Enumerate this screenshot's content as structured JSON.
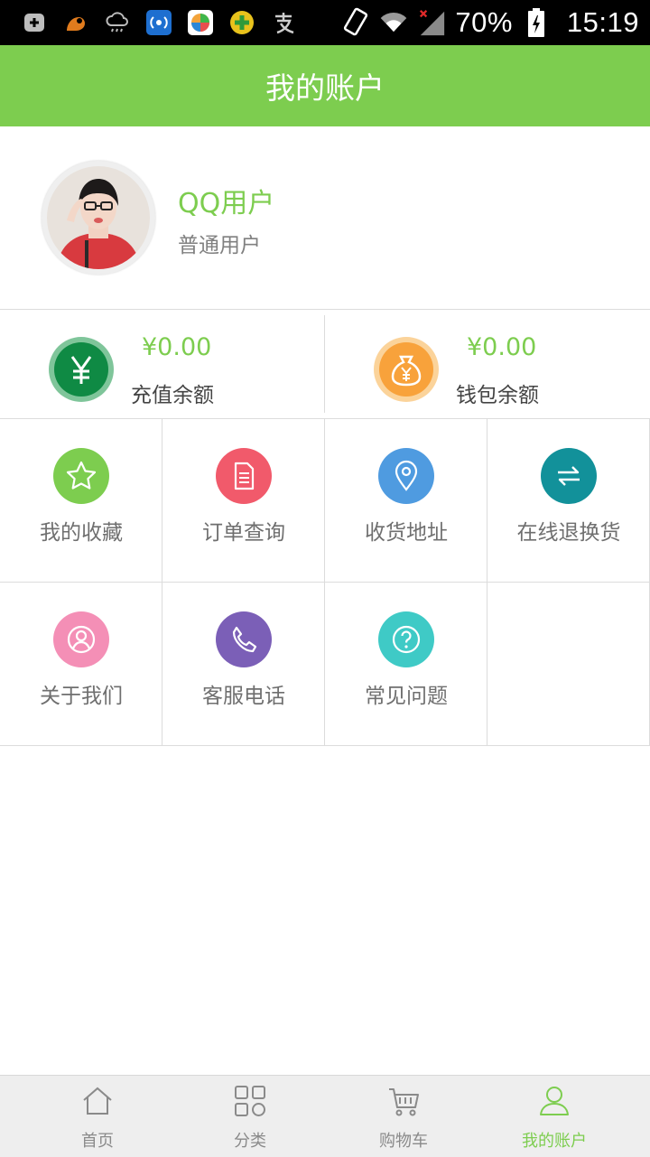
{
  "status_bar": {
    "battery_percent": "70%",
    "time": "15:19",
    "icons_left": [
      "add-icon",
      "uc-browser-icon",
      "weather-icon",
      "wifi-hotspot-icon",
      "color-app-icon",
      "plus-app-icon",
      "alipay-icon"
    ],
    "icons_right": [
      "phone-rotate-icon",
      "wifi-icon",
      "no-signal-icon",
      "battery-charging-icon"
    ]
  },
  "header": {
    "title": "我的账户"
  },
  "profile": {
    "name": "QQ用户",
    "level": "普通用户"
  },
  "balances": [
    {
      "amount": "¥0.00",
      "label": "充值余额",
      "icon": "yuan-icon",
      "color": "#0f8a44",
      "ring": "#7fc59a"
    },
    {
      "amount": "¥0.00",
      "label": "钱包余额",
      "icon": "money-bag-icon",
      "color": "#f8a23b",
      "ring": "#fbd39a"
    }
  ],
  "menu": [
    {
      "label": "我的收藏",
      "icon": "star-icon",
      "color": "#7dcd4f"
    },
    {
      "label": "订单查询",
      "icon": "document-icon",
      "color": "#f15a6b"
    },
    {
      "label": "收货地址",
      "icon": "location-pin-icon",
      "color": "#4f9be0"
    },
    {
      "label": "在线退换货",
      "icon": "exchange-icon",
      "color": "#12919a"
    },
    {
      "label": "关于我们",
      "icon": "user-circle-icon",
      "color": "#f48fb6"
    },
    {
      "label": "客服电话",
      "icon": "phone-icon",
      "color": "#7b5fb7"
    },
    {
      "label": "常见问题",
      "icon": "question-icon",
      "color": "#3fcac6"
    }
  ],
  "bottom_nav": [
    {
      "label": "首页",
      "icon": "home-icon",
      "active": false
    },
    {
      "label": "分类",
      "icon": "grid-icon",
      "active": false
    },
    {
      "label": "购物车",
      "icon": "cart-icon",
      "active": false
    },
    {
      "label": "我的账户",
      "icon": "user-icon",
      "active": true
    }
  ],
  "colors": {
    "accent": "#7dcd4f",
    "divider": "#dcdcdc",
    "label_gray": "#6f6f6f"
  }
}
